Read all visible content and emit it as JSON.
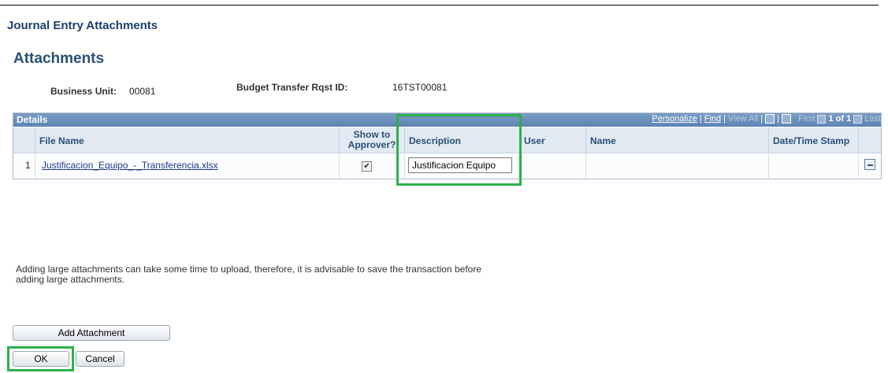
{
  "page": {
    "title": "Journal Entry Attachments",
    "section_title": "Attachments"
  },
  "header_fields": {
    "business_unit_label": "Business Unit:",
    "business_unit_value": "00081",
    "budget_transfer_label": "Budget Transfer Rqst ID:",
    "budget_transfer_value": "16TST00081"
  },
  "grid": {
    "title": "Details",
    "nav": {
      "personalize": "Personalize",
      "find": "Find",
      "view_all": "View All",
      "first": "First",
      "page_status": "1 of 1",
      "last": "Last"
    },
    "columns": [
      "File Name",
      "Show to Approver?",
      "Description",
      "User",
      "Name",
      "Date/Time Stamp"
    ],
    "rows": [
      {
        "row_number": "1",
        "file_name": "Justificacion_Equipo_-_Transferencia.xlsx",
        "show_to_approver": "✔",
        "description": "Justificacion Equipo",
        "user": "",
        "name": "",
        "date_time_stamp": ""
      }
    ]
  },
  "note": "Adding large attachments can take some time to upload, therefore, it is advisable to save the transaction before adding large attachments.",
  "buttons": {
    "add_attachment": "Add Attachment",
    "ok": "OK",
    "cancel": "Cancel"
  },
  "colors": {
    "highlight": "#2db04b",
    "grid_header": "#5d84b4",
    "link": "#1a3c8c"
  }
}
